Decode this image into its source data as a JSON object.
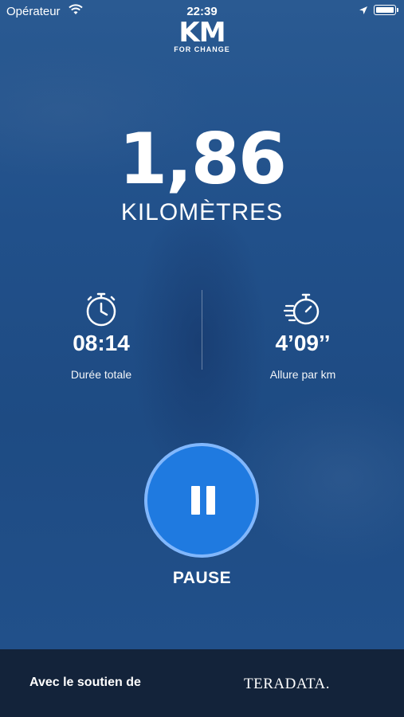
{
  "status_bar": {
    "carrier": "Opérateur",
    "time": "22:39"
  },
  "logo": {
    "main": "KM",
    "sub": "FOR CHANGE"
  },
  "run": {
    "distance": "1,86",
    "unit": "KILOMÈTRES"
  },
  "stats": {
    "duration": {
      "value": "08:14",
      "label": "Durée totale",
      "icon": "stopwatch-icon"
    },
    "pace": {
      "value": "4’09’’",
      "label": "Allure par km",
      "icon": "speed-stopwatch-icon"
    }
  },
  "controls": {
    "pause_label": "PAUSE"
  },
  "footer": {
    "support_text": "Avec le soutien de",
    "sponsor": "TERADATA."
  },
  "colors": {
    "background": "#1f4a7e",
    "button": "#1f7ae0",
    "button_ring": "#8cbeff",
    "footer": "#13233a"
  }
}
